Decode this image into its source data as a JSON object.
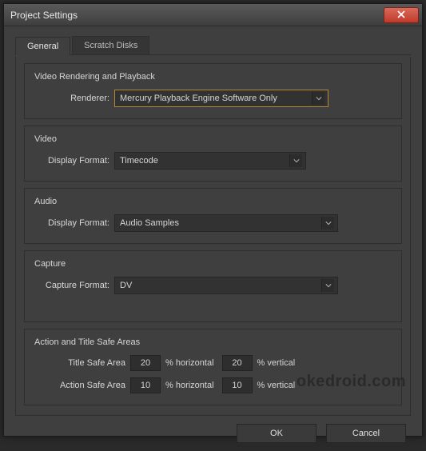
{
  "window": {
    "title": "Project Settings"
  },
  "tabs": {
    "general": "General",
    "scratch": "Scratch Disks"
  },
  "groups": {
    "rendering": {
      "title": "Video Rendering and Playback",
      "renderer_label": "Renderer:",
      "renderer_value": "Mercury Playback Engine Software Only"
    },
    "video": {
      "title": "Video",
      "format_label": "Display Format:",
      "format_value": "Timecode"
    },
    "audio": {
      "title": "Audio",
      "format_label": "Display Format:",
      "format_value": "Audio Samples"
    },
    "capture": {
      "title": "Capture",
      "format_label": "Capture Format:",
      "format_value": "DV"
    },
    "safe": {
      "title": "Action and Title Safe Areas",
      "title_safe_label": "Title Safe Area",
      "action_safe_label": "Action Safe Area",
      "title_h": "20",
      "title_v": "20",
      "action_h": "10",
      "action_v": "10",
      "unit_h": "% horizontal",
      "unit_v": "% vertical"
    }
  },
  "footer": {
    "ok": "OK",
    "cancel": "Cancel"
  },
  "watermark": "okedroid.com"
}
